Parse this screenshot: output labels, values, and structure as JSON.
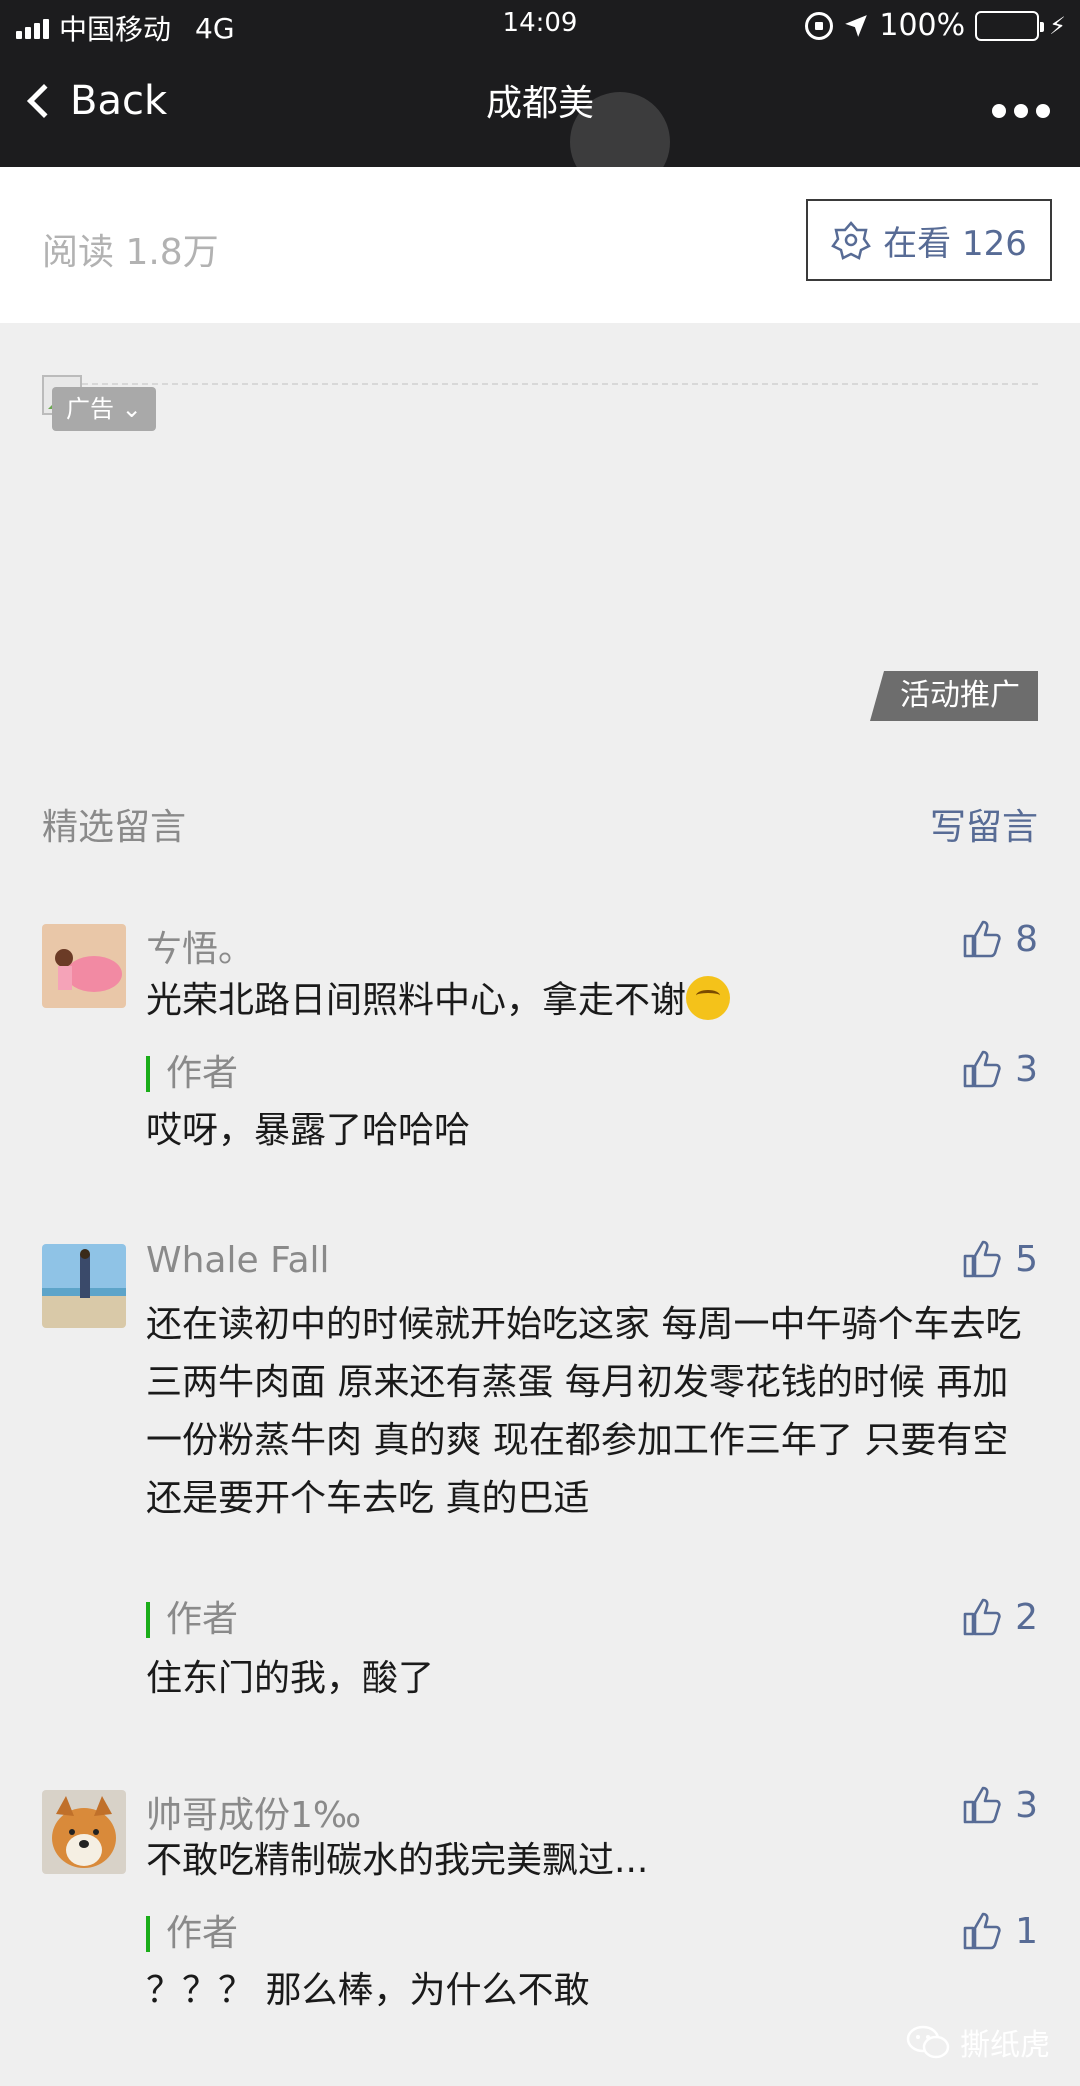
{
  "status_bar": {
    "carrier": "中国移动",
    "network": "4G",
    "time": "14:09",
    "battery_percent": "100%",
    "battery_level": 1.0,
    "icons": [
      "signal-icon",
      "orientation-lock-icon",
      "location-icon",
      "battery-icon",
      "charging-icon"
    ]
  },
  "nav": {
    "back_label": "Back",
    "title": "成都美",
    "more_icon": "more-icon"
  },
  "article_stats": {
    "read_label": "阅读 1.8万",
    "watching_label": "在看 126"
  },
  "ad": {
    "tag_label": "广告",
    "promo_label": "活动推广"
  },
  "comments_section": {
    "title": "精选留言",
    "write_label": "写留言"
  },
  "comments": [
    {
      "nickname": "ㄘ悟。",
      "text": "光荣北路日间照料中心，拿走不谢",
      "likes": "8",
      "reply": {
        "author_label": "作者",
        "text": "哎呀，暴露了哈哈哈",
        "likes": "3"
      }
    },
    {
      "nickname": "Whale Fall",
      "text": "还在读初中的时候就开始吃这家 每周一中午骑个车去吃三两牛肉面 原来还有蒸蛋 每月初发零花钱的时候 再加一份粉蒸牛肉 真的爽 现在都参加工作三年了 只要有空 还是要开个车去吃 真的巴适",
      "likes": "5",
      "reply": {
        "author_label": "作者",
        "text": "住东门的我，酸了",
        "likes": "2"
      }
    },
    {
      "nickname": "帅哥成份1‰",
      "text": "不敢吃精制碳水的我完美飘过...",
      "likes": "3",
      "reply": {
        "author_label": "作者",
        "text": "？？？ 那么棒，为什么不敢",
        "likes": "1"
      }
    }
  ],
  "watermark": "撕纸虎",
  "colors": {
    "nav_bg": "#1c1c1e",
    "link": "#576b95",
    "author_bar": "#1aad19",
    "battery": "#4cd964",
    "page_bg": "#efefef"
  }
}
